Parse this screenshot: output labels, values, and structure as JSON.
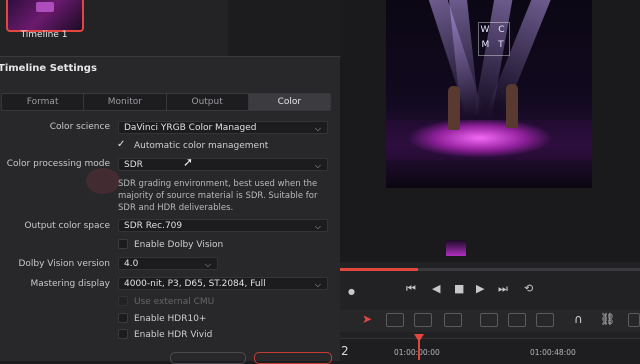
{
  "media_pool": {
    "thumbnail_label": "Timeline 1"
  },
  "viewer": {
    "stage_sign": [
      "W C",
      "M T"
    ]
  },
  "dialog": {
    "title": "Timeline Settings",
    "tabs": [
      {
        "label": "Format",
        "active": false
      },
      {
        "label": "Monitor",
        "active": false
      },
      {
        "label": "Output",
        "active": false
      },
      {
        "label": "Color",
        "active": true
      }
    ],
    "fields": {
      "color_science": {
        "label": "Color science",
        "value": "DaVinci YRGB Color Managed"
      },
      "auto_color_mgmt": {
        "label": "Automatic color management",
        "checked": true
      },
      "color_processing_mode": {
        "label": "Color processing mode",
        "value": "SDR",
        "description": "SDR grading environment, best used when the majority of source material is SDR. Suitable for SDR and HDR deliverables."
      },
      "output_color_space": {
        "label": "Output color space",
        "value": "SDR Rec.709"
      },
      "enable_dolby_vision": {
        "label": "Enable Dolby Vision",
        "checked": false
      },
      "dolby_vision_version": {
        "label": "Dolby Vision version",
        "value": "4.0"
      },
      "mastering_display": {
        "label": "Mastering display",
        "value": "4000-nit, P3, D65, ST.2084, Full"
      },
      "use_external_cmu": {
        "label": "Use external CMU",
        "checked": false,
        "disabled": true
      },
      "enable_hdr10plus": {
        "label": "Enable HDR10+",
        "checked": false
      },
      "enable_hdr_vivid": {
        "label": "Enable HDR Vivid",
        "checked": false
      }
    }
  },
  "timeline": {
    "timecode_1": "01:00:00:00",
    "timecode_2": "01:00:48:00",
    "track_number": "2"
  },
  "colors": {
    "accent": "#e2463f",
    "dialog_bg": "#28282b"
  }
}
